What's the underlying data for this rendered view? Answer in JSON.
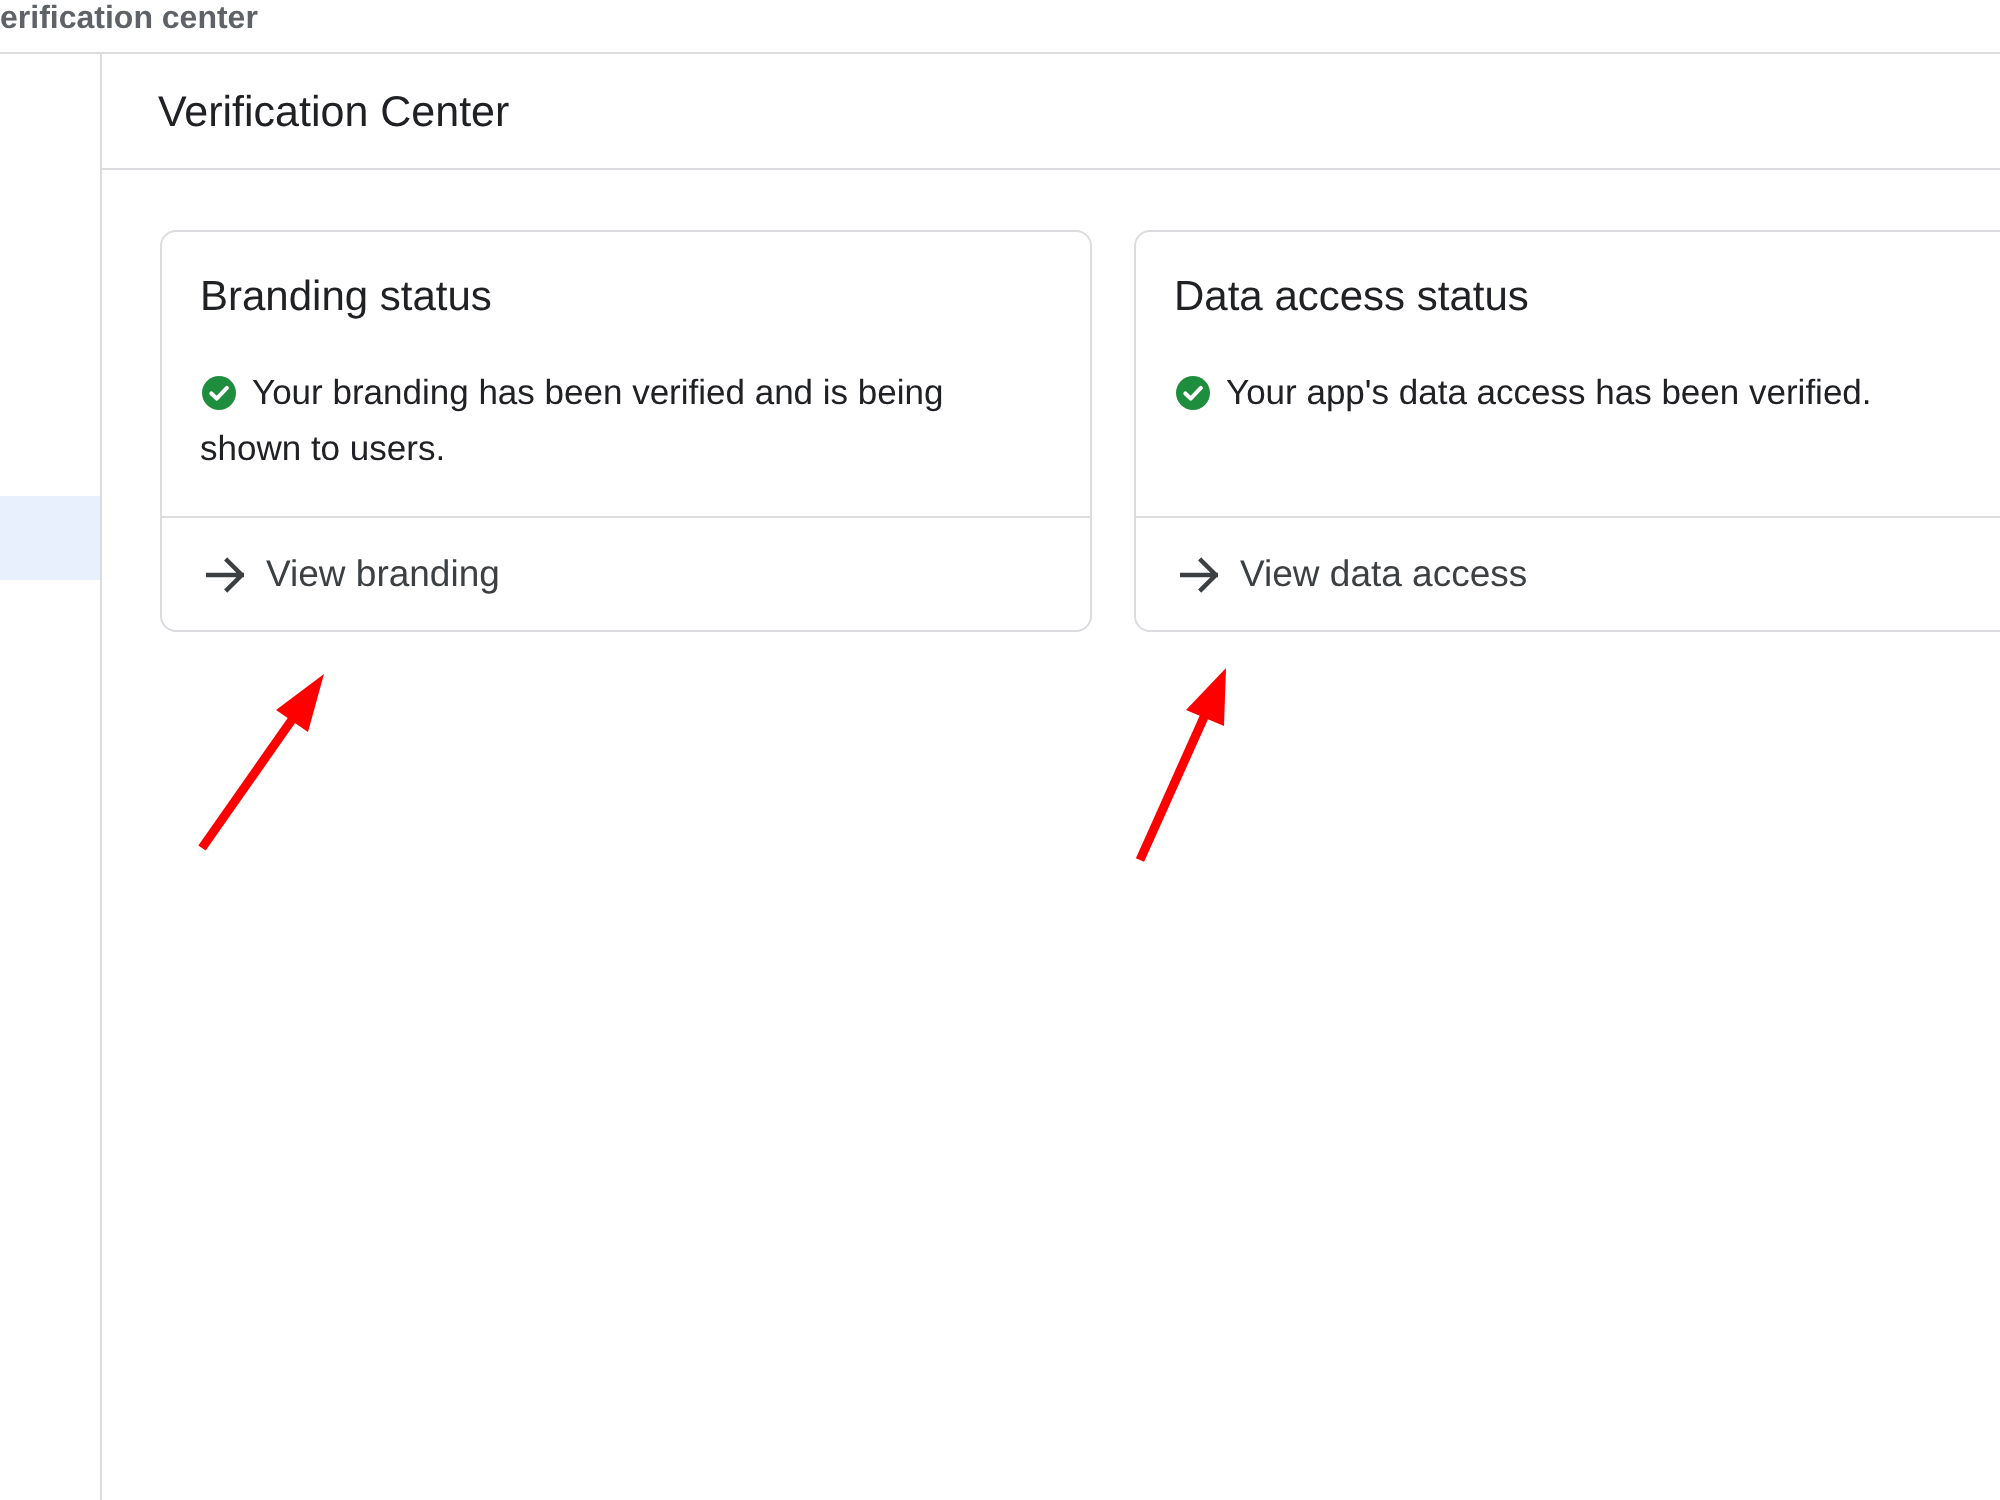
{
  "top_bar": {
    "title": "erification center"
  },
  "sidebar": {
    "items": [
      {
        "selected": true
      }
    ]
  },
  "page": {
    "title": "Verification Center"
  },
  "cards": [
    {
      "title": "Branding status",
      "verified": true,
      "message": "Your branding has been verified and is being shown to users.",
      "link": "View branding",
      "arrow_annotation": true
    },
    {
      "title": "Data access status",
      "verified": true,
      "message": "Your app's data access has been verified.",
      "link": "View data access",
      "arrow_annotation": true
    }
  ]
}
